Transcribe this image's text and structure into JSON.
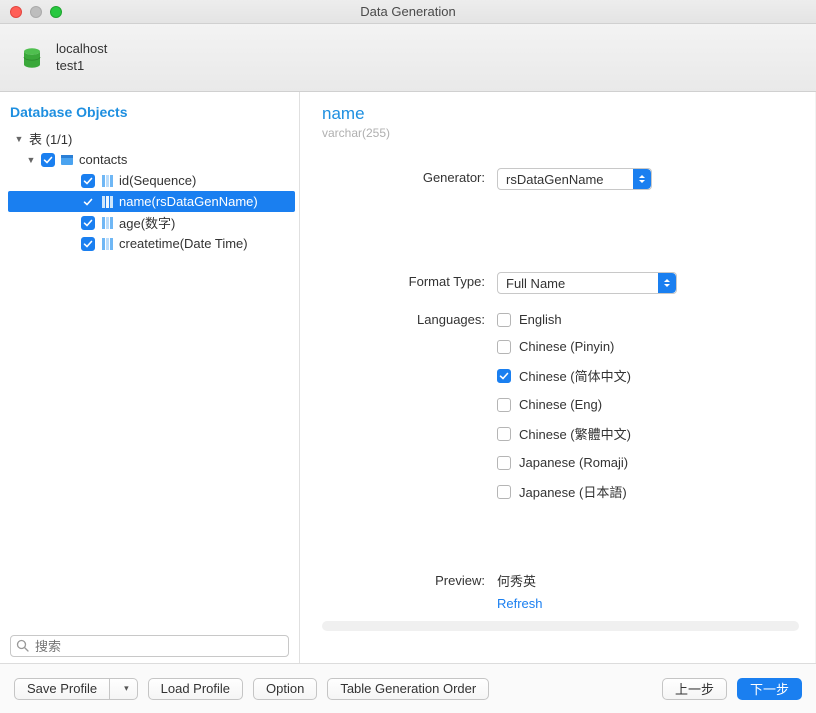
{
  "window": {
    "title": "Data Generation"
  },
  "connection": {
    "host": "localhost",
    "database": "test1"
  },
  "sidebar": {
    "title": "Database Objects",
    "root_label": "表 (1/1)",
    "table": {
      "name": "contacts",
      "columns": [
        {
          "label": "id(Sequence)",
          "checked": true,
          "selected": false
        },
        {
          "label": "name(rsDataGenName)",
          "checked": true,
          "selected": true
        },
        {
          "label": "age(数字)",
          "checked": true,
          "selected": false
        },
        {
          "label": "createtime(Date Time)",
          "checked": true,
          "selected": false
        }
      ]
    },
    "search_placeholder": "搜索"
  },
  "detail": {
    "column_name": "name",
    "column_type": "varchar(255)",
    "generator_label": "Generator:",
    "generator_value": "rsDataGenName",
    "format_type_label": "Format Type:",
    "format_type_value": "Full Name",
    "languages_label": "Languages:",
    "languages": [
      {
        "label": "English",
        "checked": false
      },
      {
        "label": "Chinese (Pinyin)",
        "checked": false
      },
      {
        "label": "Chinese (简体中文)",
        "checked": true
      },
      {
        "label": "Chinese (Eng)",
        "checked": false
      },
      {
        "label": "Chinese (繁體中文)",
        "checked": false
      },
      {
        "label": "Japanese (Romaji)",
        "checked": false
      },
      {
        "label": "Japanese (日本語)",
        "checked": false
      }
    ],
    "preview_label": "Preview:",
    "preview_value": "何秀英",
    "refresh_label": "Refresh"
  },
  "footer": {
    "save_profile": "Save Profile",
    "load_profile": "Load Profile",
    "option": "Option",
    "table_gen_order": "Table Generation Order",
    "prev": "上一步",
    "next": "下一步"
  }
}
